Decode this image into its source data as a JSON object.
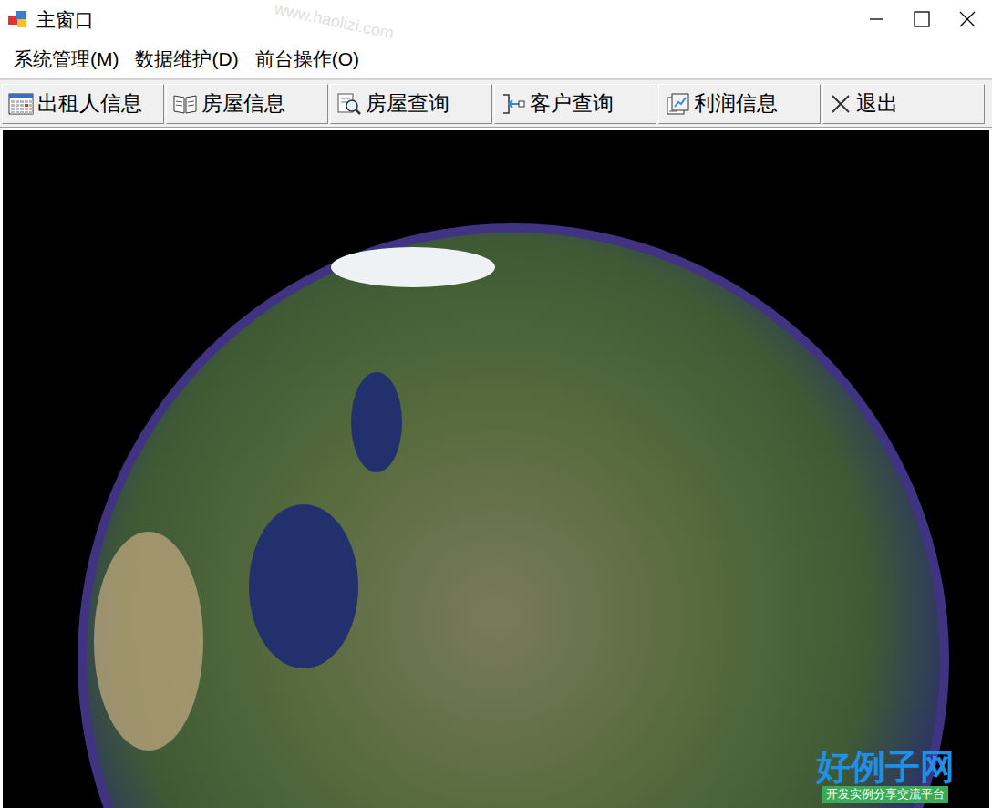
{
  "window": {
    "title": "主窗口"
  },
  "menu": [
    {
      "label": "系统管理(M)"
    },
    {
      "label": "数据维护(D)"
    },
    {
      "label": "前台操作(O)"
    }
  ],
  "toolbar": [
    {
      "label": "出租人信息"
    },
    {
      "label": "房屋信息"
    },
    {
      "label": "房屋查询"
    },
    {
      "label": "客户查询"
    },
    {
      "label": "利润信息"
    },
    {
      "label": "退出"
    }
  ],
  "watermark": {
    "site": "www.haolizi.com",
    "logo": "好例子网",
    "tagline": "开发实例分享交流平台"
  }
}
